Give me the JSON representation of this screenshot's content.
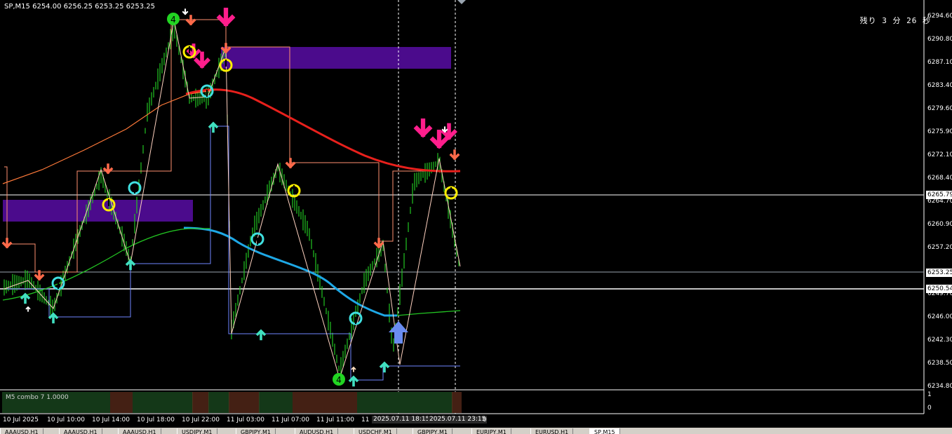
{
  "header": {
    "symbol_info": "SP,M15  6254.00 6256.25 6253.25 6253.25"
  },
  "countdown": "残り 3 分 26 秒",
  "price_axis": [
    "6294.60",
    "6290.80",
    "6287.10",
    "6283.40",
    "6279.60",
    "6275.90",
    "6272.10",
    "6268.40",
    "6264.70",
    "6260.90",
    "6257.20",
    "6249.70",
    "6246.00",
    "6242.30",
    "6238.50",
    "6234.80"
  ],
  "price_tags": {
    "upper": "6265.79",
    "current": "6253.25",
    "lower": "6250.54"
  },
  "time_axis": [
    "10 Jul 2025",
    "10 Jul 10:00",
    "10 Jul 14:00",
    "10 Jul 18:00",
    "10 Jul 22:00",
    "11 Jul 03:00",
    "11 Jul 07:00",
    "11 Jul 11:00",
    "11"
  ],
  "time_highlight": [
    "2025.07.11 18:15",
    "2025.07.11 23:15"
  ],
  "time_axis_tail": "0",
  "subwindow": {
    "label": "M5 combo 7  1.0000",
    "axis_top": "1",
    "axis_bottom": "0"
  },
  "signals": {
    "wave_label_top": "4",
    "wave_label_bottom": "4"
  },
  "colors": {
    "bullish_bar": "#22c422",
    "ma_red": "#e8201c",
    "ma_blue": "#1ea8e6",
    "ma_green": "#22c422",
    "zone": "#4b0b8c",
    "sell_arrow": "#ff1e8c",
    "buy_arrow": "#40e0c0"
  },
  "tabs": [
    "AAAUSD,H1",
    "AAAUSD,H1",
    "AAAUSD,H1",
    "USDJPY,M1",
    "GBPJPY,M1",
    "AUDUSD,H1",
    "USDCHF,M1",
    "GBPJPY,M1",
    "EURJPY,M1",
    "EURUSD,H1",
    "SP,M15"
  ]
}
